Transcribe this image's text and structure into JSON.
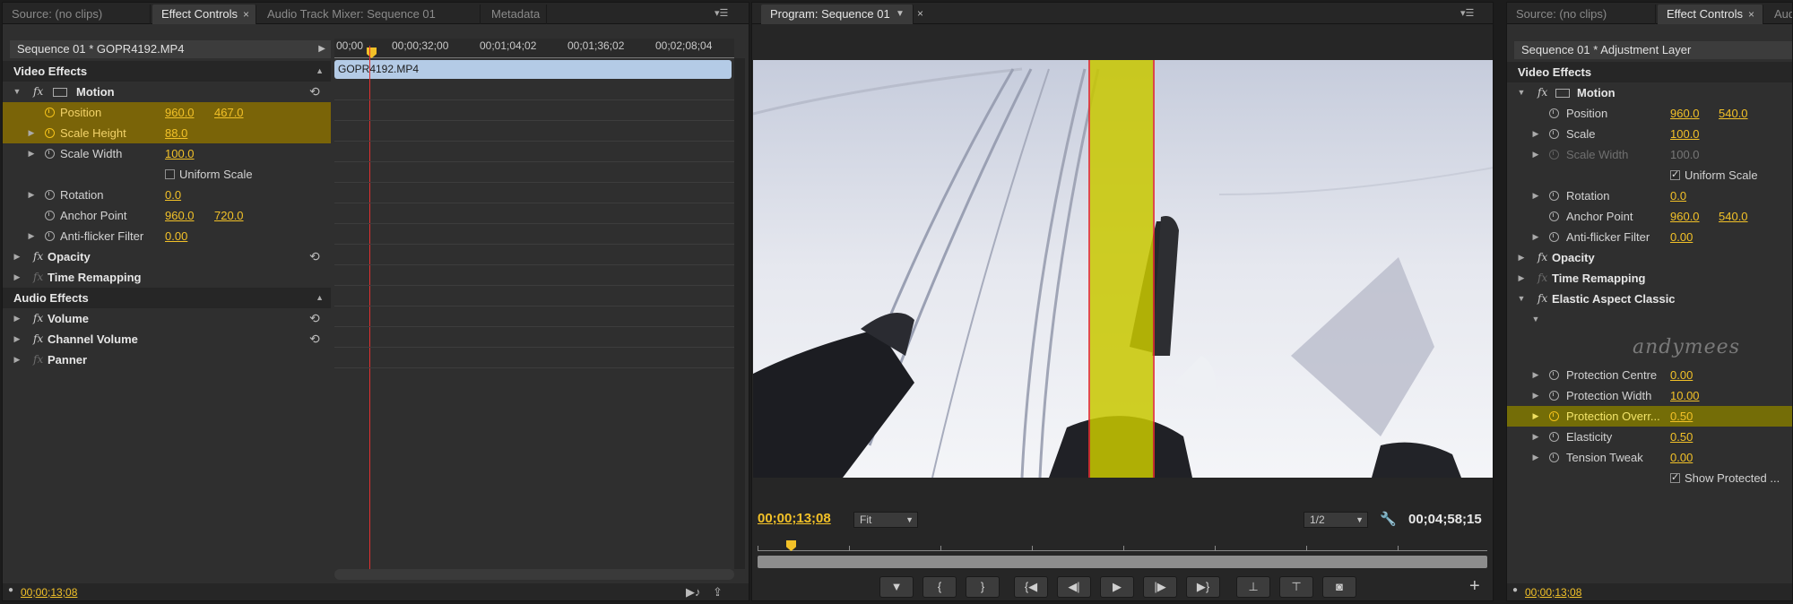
{
  "left_panel": {
    "tabs": [
      "Source: (no clips)",
      "Effect Controls",
      "Audio Track Mixer: Sequence 01",
      "Metadata"
    ],
    "clip_header": "Sequence 01 * GOPR4192.MP4",
    "ruler_labels": [
      "00;00",
      "00;00;32;00",
      "00;01;04;02",
      "00;01;36;02",
      "00;02;08;04"
    ],
    "clip_name": "GOPR4192.MP4",
    "video_effects": "Video Effects",
    "audio_effects": "Audio Effects",
    "motion": "Motion",
    "position": {
      "label": "Position",
      "x": "960.0",
      "y": "467.0"
    },
    "scale_height": {
      "label": "Scale Height",
      "value": "88.0"
    },
    "scale_width": {
      "label": "Scale Width",
      "value": "100.0"
    },
    "uniform_scale": "Uniform Scale",
    "rotation": {
      "label": "Rotation",
      "value": "0.0"
    },
    "anchor_point": {
      "label": "Anchor Point",
      "x": "960.0",
      "y": "720.0"
    },
    "anti_flicker": {
      "label": "Anti-flicker Filter",
      "value": "0.00"
    },
    "opacity": "Opacity",
    "time_remapping": "Time Remapping",
    "volume": "Volume",
    "channel_volume": "Channel Volume",
    "panner": "Panner",
    "timecode": "00;00;13;08"
  },
  "program_monitor": {
    "tab": "Program: Sequence 01",
    "timecode": "00;00;13;08",
    "fit": "Fit",
    "resolution": "1/2",
    "duration": "00;04;58;15"
  },
  "right_panel": {
    "tabs": [
      "Source: (no clips)",
      "Effect Controls",
      "Aud"
    ],
    "clip_header": "Sequence 01 * Adjustment Layer",
    "video_effects": "Video Effects",
    "motion": "Motion",
    "position": {
      "label": "Position",
      "x": "960.0",
      "y": "540.0"
    },
    "scale": {
      "label": "Scale",
      "value": "100.0"
    },
    "scale_width": {
      "label": "Scale Width",
      "value": "100.0"
    },
    "uniform_scale": "Uniform Scale",
    "rotation": {
      "label": "Rotation",
      "value": "0.0"
    },
    "anchor_point": {
      "label": "Anchor Point",
      "x": "960.0",
      "y": "540.0"
    },
    "anti_flicker": {
      "label": "Anti-flicker Filter",
      "value": "0.00"
    },
    "opacity": "Opacity",
    "time_remapping": "Time Remapping",
    "elastic": "Elastic Aspect Classic",
    "signature": "andymees",
    "protection_centre": {
      "label": "Protection Centre",
      "value": "0.00"
    },
    "protection_width": {
      "label": "Protection Width",
      "value": "10.00"
    },
    "protection_override": {
      "label": "Protection Overr...",
      "value": "0.50"
    },
    "elasticity": {
      "label": "Elasticity",
      "value": "0.50"
    },
    "tension_tweak": {
      "label": "Tension Tweak",
      "value": "0.00"
    },
    "show_protected": "Show Protected ...",
    "timecode": "00;00;13;08"
  },
  "colors": {
    "accent": "#f2c128",
    "highlight": "#7a6408",
    "band": "#c9c800",
    "playhead": "#e03030"
  }
}
